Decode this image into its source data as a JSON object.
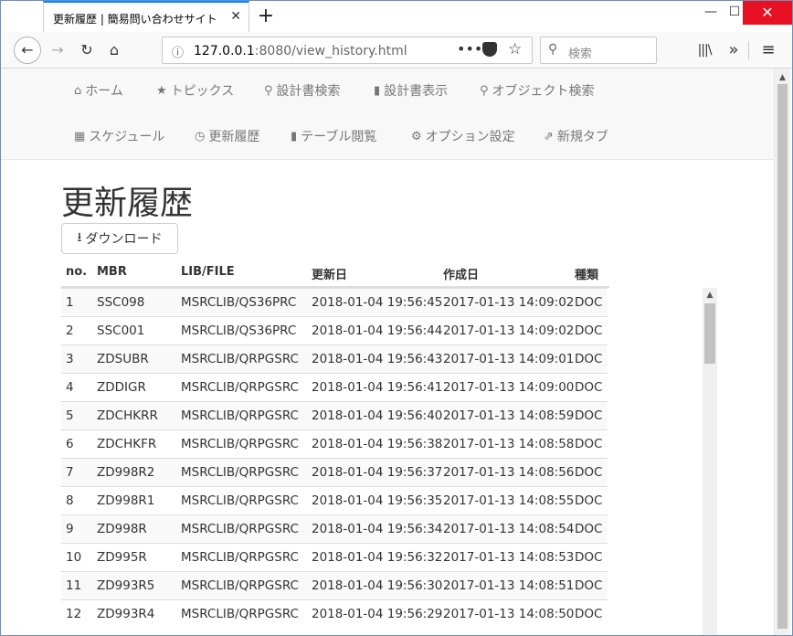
{
  "browser": {
    "tab_title": "更新履歴 | 簡易問い合わせサイト",
    "tab_close": "✕",
    "new_tab": "+",
    "url_host": "127.0.0.1",
    "url_rest": ":8080/view_history.html",
    "search_placeholder": "検索",
    "icons": [
      "back-arrow-icon",
      "forward-arrow-icon",
      "reload-icon",
      "home-icon",
      "info-icon",
      "more-dots-icon",
      "pocket-icon",
      "star-icon",
      "search-icon",
      "library-icon",
      "overflow-icon",
      "hamburger-menu-icon"
    ]
  },
  "site_nav": {
    "row1": [
      {
        "icon": "home-icon",
        "glyph": "⌂",
        "label": "ホーム"
      },
      {
        "icon": "star-icon",
        "glyph": "★",
        "label": "トピックス"
      },
      {
        "icon": "search-icon",
        "glyph": "⚲",
        "label": "設計書検索"
      },
      {
        "icon": "book-icon",
        "glyph": "▮",
        "label": "設計書表示"
      },
      {
        "icon": "search-icon",
        "glyph": "⚲",
        "label": "オブジェクト検索"
      }
    ],
    "row2": [
      {
        "icon": "calendar-icon",
        "glyph": "▦",
        "label": "スケジュール"
      },
      {
        "icon": "clock-icon",
        "glyph": "◷",
        "label": "更新履歴"
      },
      {
        "icon": "book-icon",
        "glyph": "▮",
        "label": "テーブル閲覧"
      },
      {
        "icon": "gear-icon",
        "glyph": "⚙",
        "label": "オプション設定"
      },
      {
        "icon": "external-link-icon",
        "glyph": "⇗",
        "label": "新規タブ"
      }
    ]
  },
  "main": {
    "title": "更新履歴",
    "download_label": "ダウンロード"
  },
  "table": {
    "headers": [
      "no.",
      "MBR",
      "LIB/FILE",
      "更新日",
      "作成日",
      "種類"
    ],
    "rows": [
      [
        "1",
        "SSC098",
        "MSRCLIB/QS36PRC",
        "2018-01-04 19:56:45",
        "2017-01-13 14:09:02",
        "DOC"
      ],
      [
        "2",
        "SSC001",
        "MSRCLIB/QS36PRC",
        "2018-01-04 19:56:44",
        "2017-01-13 14:09:02",
        "DOC"
      ],
      [
        "3",
        "ZDSUBR",
        "MSRCLIB/QRPGSRC",
        "2018-01-04 19:56:43",
        "2017-01-13 14:09:01",
        "DOC"
      ],
      [
        "4",
        "ZDDIGR",
        "MSRCLIB/QRPGSRC",
        "2018-01-04 19:56:41",
        "2017-01-13 14:09:00",
        "DOC"
      ],
      [
        "5",
        "ZDCHKRR",
        "MSRCLIB/QRPGSRC",
        "2018-01-04 19:56:40",
        "2017-01-13 14:08:59",
        "DOC"
      ],
      [
        "6",
        "ZDCHKFR",
        "MSRCLIB/QRPGSRC",
        "2018-01-04 19:56:38",
        "2017-01-13 14:08:58",
        "DOC"
      ],
      [
        "7",
        "ZD998R2",
        "MSRCLIB/QRPGSRC",
        "2018-01-04 19:56:37",
        "2017-01-13 14:08:56",
        "DOC"
      ],
      [
        "8",
        "ZD998R1",
        "MSRCLIB/QRPGSRC",
        "2018-01-04 19:56:35",
        "2017-01-13 14:08:55",
        "DOC"
      ],
      [
        "9",
        "ZD998R",
        "MSRCLIB/QRPGSRC",
        "2018-01-04 19:56:34",
        "2017-01-13 14:08:54",
        "DOC"
      ],
      [
        "10",
        "ZD995R",
        "MSRCLIB/QRPGSRC",
        "2018-01-04 19:56:32",
        "2017-01-13 14:08:53",
        "DOC"
      ],
      [
        "11",
        "ZD993R5",
        "MSRCLIB/QRPGSRC",
        "2018-01-04 19:56:30",
        "2017-01-13 14:08:51",
        "DOC"
      ],
      [
        "12",
        "ZD993R4",
        "MSRCLIB/QRPGSRC",
        "2018-01-04 19:56:29",
        "2017-01-13 14:08:50",
        "DOC"
      ]
    ]
  }
}
